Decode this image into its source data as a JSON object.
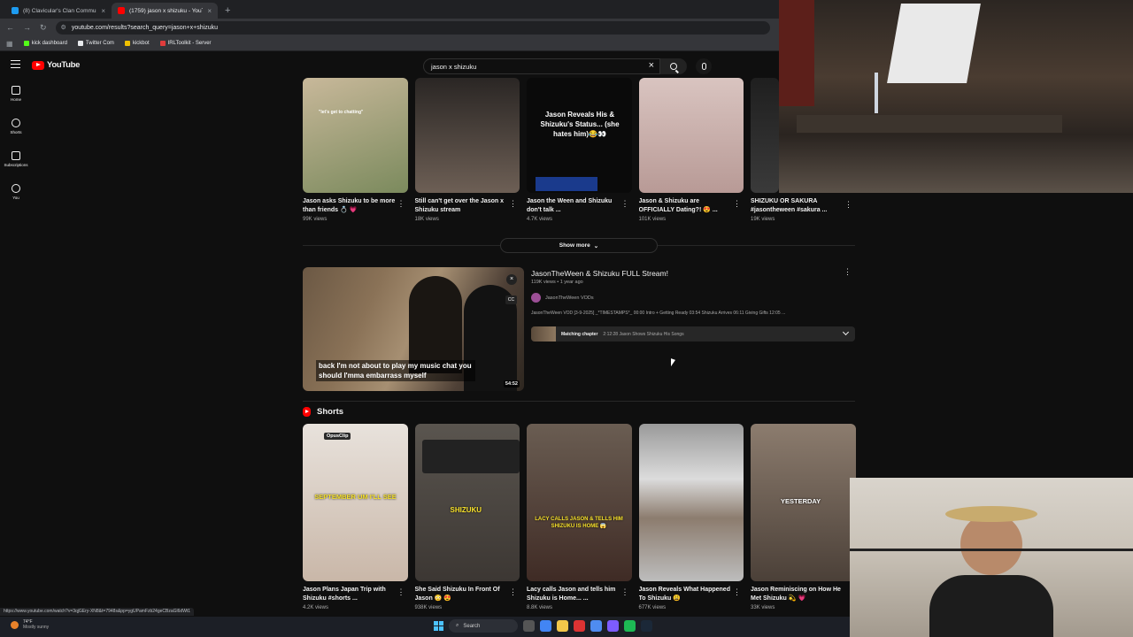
{
  "browser": {
    "tabs": [
      {
        "title": "(8) Clavicular's Clan Communit...",
        "favicon_color": "#1d9bf0"
      },
      {
        "title": "(1759) jason x shizuku - YouTu...",
        "favicon_color": "#ff0000"
      }
    ],
    "new_tab": "+",
    "url": "youtube.com/results?search_query=jason+x+shizuku",
    "bookmarks": [
      {
        "label": "kick dashboard",
        "color": "#53fc18"
      },
      {
        "label": "Twitter Com",
        "color": "#1d9bf0"
      },
      {
        "label": "kickbot",
        "color": "#f0c000"
      },
      {
        "label": "IRLToolkit - Server",
        "color": "#e03c3c"
      }
    ]
  },
  "youtube": {
    "logo_text": "YouTube",
    "search_value": "jason x shizuku",
    "sidebar": [
      {
        "label": "Home",
        "icon": "home-icon"
      },
      {
        "label": "Shorts",
        "icon": "shorts-icon"
      },
      {
        "label": "Subscriptions",
        "icon": "subscriptions-icon"
      },
      {
        "label": "You",
        "icon": "you-icon"
      }
    ]
  },
  "top_row": [
    {
      "title": "Jason asks Shizuku to be more than friends 💍 💗",
      "views": "99K views",
      "overlay": "\"let's get to chatting\"",
      "colors": [
        "#c8b89a",
        "#7b8a5d"
      ]
    },
    {
      "title": "Still can't get over the Jason x Shizuku stream",
      "views": "18K views",
      "overlay": "",
      "colors": [
        "#2a2624",
        "#6d5f55"
      ]
    },
    {
      "title": "Jason the Ween and Shizuku don't talk ...",
      "views": "4.7K views",
      "overlay": "Jason Reveals His & Shizuku's Status... (she hates him)😂👀",
      "colors": [
        "#0a0a0a",
        "#151515"
      ]
    },
    {
      "title": "Jason & Shizuku are OFFICIALLY Dating?! 😍 ...",
      "views": "101K views",
      "overlay": "",
      "colors": [
        "#d9c4c0",
        "#b89a96"
      ]
    },
    {
      "title": "SHIZUKU OR SAKURA #jasontheween #sakura ...",
      "views": "19K views",
      "overlay": "",
      "colors": [
        "#1f1f1f",
        "#3a3a3a"
      ]
    }
  ],
  "show_more": "Show more",
  "featured": {
    "title": "JasonTheWeen & Shizuku FULL Stream!",
    "meta": "119K views • 1 year ago",
    "channel": "JasonTheWeen VODs",
    "description": "JasonTheWeen VOD [3-9-2025] _*TIMESTAMPS*_ 00:00 Intro + Getting Ready 03:54 Shizuku Arrives 06:11 Giving Gifts 12:05 ...",
    "chapter_label": "Matching chapter",
    "chapter_text": "2:12:28 Jason Shows Shizuku His Songs",
    "caption": "back I'm not about to play my music chat you should I'mma embarrass myself",
    "duration": "54:52",
    "cc": "CC"
  },
  "shorts_heading": "Shorts",
  "shorts": [
    {
      "title": "Jason Plans Japan Trip with Shizuku #shorts ...",
      "views": "4.2K views",
      "overlay": "SEPTEMBER UM I'LL SEE",
      "badge": "OpusClip",
      "colors": [
        "#e8e2dc",
        "#c9b7a8"
      ]
    },
    {
      "title": "She Said Shizuku In Front Of Jason 😳 😍",
      "views": "938K views",
      "overlay": "SHIZUKU",
      "badge": "",
      "colors": [
        "#5a554f",
        "#3c3733"
      ]
    },
    {
      "title": "Lacy calls Jason and tells him Shizuku is Home... ...",
      "views": "8.8K views",
      "overlay": "LACY CALLS JASON & TELLS HIM SHIZUKU IS HOME 😱",
      "badge": "",
      "colors": [
        "#6a5d52",
        "#3f2b25"
      ]
    },
    {
      "title": "Jason Reveals What Happened To Shizuku 😩",
      "views": "677K views",
      "overlay": "",
      "badge": "",
      "colors": [
        "#9a9a9a",
        "#dcdcdc"
      ]
    },
    {
      "title": "Jason Reminiscing on How He Met Shizuku 💫 💗",
      "views": "33K views",
      "overlay": "YESTERDAY",
      "badge": "",
      "colors": [
        "#8c7c6e",
        "#4b4038"
      ]
    }
  ],
  "status_url": "https://www.youtube.com/watch?v=3qjGEry-XN8&t=7948s&pp=ygUPamFzb24geCBzaGl6dWt1",
  "taskbar": {
    "temp": "74°F",
    "weather": "Mostly sunny",
    "search": "Search"
  }
}
